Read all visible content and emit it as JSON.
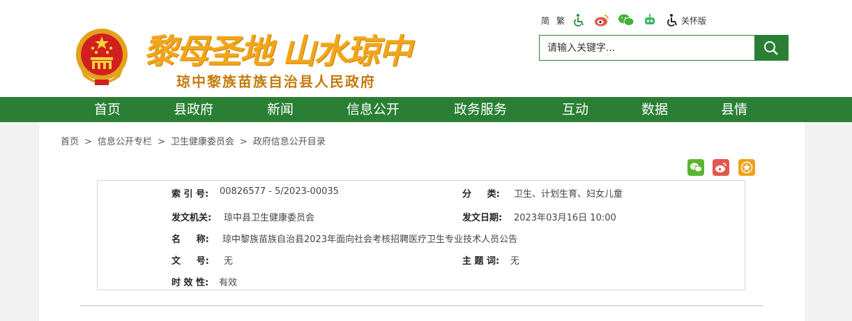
{
  "header": {
    "slogan": "黎母圣地 山水琼中",
    "gov_name": "琼中黎族苗族自治县人民政府"
  },
  "tools": {
    "simplified": "简",
    "traditional": "繁",
    "icons": [
      "accessibility-icon",
      "weibo-icon",
      "wechat-icon",
      "robot-icon",
      "elder-mode-icon"
    ],
    "elder_mode": "关怀版"
  },
  "search": {
    "placeholder": "请输入关键字..."
  },
  "nav": [
    "首页",
    "县政府",
    "新闻",
    "信息公开",
    "政务服务",
    "互动",
    "数据",
    "县情"
  ],
  "breadcrumb": [
    "首页",
    "信息公开专栏",
    "卫生健康委员会",
    "政府信息公开目录"
  ],
  "breadcrumb_sep": ">",
  "meta": {
    "index_label": "索 引 号:",
    "index_value": "00826577 - 5/2023-00035",
    "category_label": "分     类:",
    "category_value": "卫生、计划生育、妇女儿童",
    "issuer_label": "发文机关:",
    "issuer_value": "琼中县卫生健康委员会",
    "date_label": "发文日期:",
    "date_value": "2023年03月16日 10:00",
    "title_label": "名     称:",
    "title_value": "琼中黎族苗族自治县2023年面向社会考核招聘医疗卫生专业技术人员公告",
    "docno_label": "文     号:",
    "docno_value": "无",
    "keywords_label": "主 题 词:",
    "keywords_value": "无",
    "validity_label": "时 效 性:",
    "validity_value": "有效"
  },
  "colors": {
    "brand_green": "#2a7f35",
    "slogan_gold": "#f2a618",
    "wechat": "#5cb531",
    "weibo": "#e2574c",
    "favorite": "#f0a21b"
  }
}
